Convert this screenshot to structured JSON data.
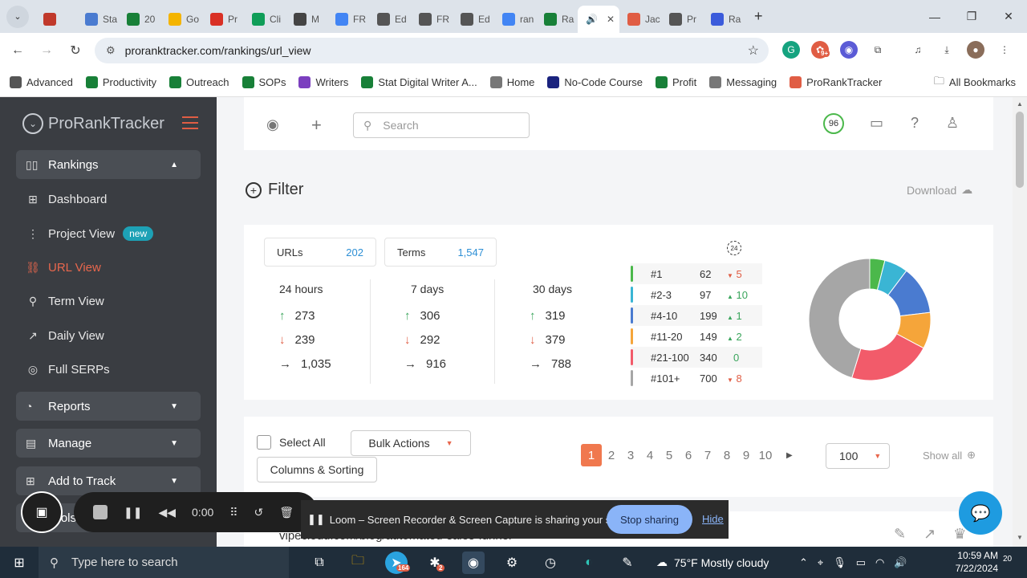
{
  "browser": {
    "tabs": [
      {
        "label": "",
        "color": "#c0392b"
      },
      {
        "label": "Sta",
        "color": "#4a7bd0"
      },
      {
        "label": "20",
        "color": "#188038"
      },
      {
        "label": "Go",
        "color": "#f4b400"
      },
      {
        "label": "Pr",
        "color": "#d93025"
      },
      {
        "label": "Cli",
        "color": "#0f9d58"
      },
      {
        "label": "M",
        "color": "#444"
      },
      {
        "label": "FR",
        "color": "#4285f4"
      },
      {
        "label": "Ed",
        "color": "#555"
      },
      {
        "label": "FR",
        "color": "#555"
      },
      {
        "label": "Ed",
        "color": "#555"
      },
      {
        "label": "ran",
        "color": "#4285f4"
      },
      {
        "label": "Ra",
        "color": "#188038"
      }
    ],
    "active_tab_close": "✕",
    "tabs_after": [
      {
        "label": "Jac",
        "color": "#e05d44"
      },
      {
        "label": "Pr",
        "color": "#555"
      },
      {
        "label": "Ra",
        "color": "#3b5bdb"
      }
    ],
    "url": "proranktracker.com/rankings/url_view",
    "bookmarks": [
      {
        "label": "Advanced",
        "color": "#555"
      },
      {
        "label": "Productivity",
        "color": "#188038"
      },
      {
        "label": "Outreach",
        "color": "#188038"
      },
      {
        "label": "SOPs",
        "color": "#188038"
      },
      {
        "label": "Writers",
        "color": "#7b3fbf"
      },
      {
        "label": "Stat Digital Writer A...",
        "color": "#188038"
      },
      {
        "label": "Home",
        "color": "#777"
      },
      {
        "label": "No-Code Course",
        "color": "#1a237e"
      },
      {
        "label": "Profit",
        "color": "#188038"
      },
      {
        "label": "Messaging",
        "color": "#777"
      },
      {
        "label": "ProRankTracker",
        "color": "#e05d44"
      }
    ],
    "all_bookmarks": "All Bookmarks",
    "ext_badge": "9+"
  },
  "sidebar": {
    "logo": "ProRankTracker",
    "sections": {
      "rankings": "Rankings",
      "reports": "Reports",
      "manage": "Manage",
      "add_to_track": "Add to Track",
      "tools": "Tools"
    },
    "items": [
      {
        "label": "Dashboard",
        "icon": "⊞"
      },
      {
        "label": "Project View",
        "icon": "⋮",
        "badge": "new"
      },
      {
        "label": "URL View",
        "icon": "🔗"
      },
      {
        "label": "Term View",
        "icon": "⚲"
      },
      {
        "label": "Daily View",
        "icon": "↗"
      },
      {
        "label": "Full SERPs",
        "icon": "◎"
      }
    ]
  },
  "topbar": {
    "search_placeholder": "Search",
    "score": "96"
  },
  "filter": {
    "label": "Filter",
    "download": "Download"
  },
  "stats": {
    "urls_label": "URLs",
    "urls_value": "202",
    "terms_label": "Terms",
    "terms_value": "1,547",
    "periods": [
      {
        "label": "24 hours",
        "up": "273",
        "down": "239",
        "same": "1,035"
      },
      {
        "label": "7 days",
        "up": "306",
        "down": "292",
        "same": "916"
      },
      {
        "label": "30 days",
        "up": "319",
        "down": "379",
        "same": "788"
      }
    ],
    "timer": "24",
    "ranks": [
      {
        "label": "#1",
        "count": "62",
        "delta": "5",
        "dir": "down",
        "color": "#4bb84b"
      },
      {
        "label": "#2-3",
        "count": "97",
        "delta": "10",
        "dir": "up",
        "color": "#3ab5d4"
      },
      {
        "label": "#4-10",
        "count": "199",
        "delta": "1",
        "dir": "up",
        "color": "#4a7bd0"
      },
      {
        "label": "#11-20",
        "count": "149",
        "delta": "2",
        "dir": "up",
        "color": "#f5a53a"
      },
      {
        "label": "#21-100",
        "count": "340",
        "delta": "0",
        "dir": "none",
        "color": "#f25b6a"
      },
      {
        "label": "#101+",
        "count": "700",
        "delta": "8",
        "dir": "down",
        "color": "#a6a6a6"
      }
    ]
  },
  "list": {
    "select_all": "Select All",
    "bulk_actions": "Bulk Actions",
    "columns_sorting": "Columns & Sorting",
    "pages": [
      "1",
      "2",
      "3",
      "4",
      "5",
      "6",
      "7",
      "8",
      "9",
      "10"
    ],
    "current_page": "1",
    "per_page": "100",
    "show_all": "Show all",
    "first_url": "vipecloud.com/blog/automated-sales-funnel"
  },
  "loom": {
    "time": "0:00",
    "message": "Loom – Screen Recorder & Screen Capture is sharing your screen.",
    "stop_sharing": "Stop sharing",
    "hide": "Hide"
  },
  "taskbar": {
    "search_placeholder": "Type here to search",
    "telegram_badge": "164",
    "slack_badge": "2",
    "weather": "75°F  Mostly cloudy",
    "time": "10:59 AM",
    "date": "7/22/2024",
    "notifications": "20"
  }
}
